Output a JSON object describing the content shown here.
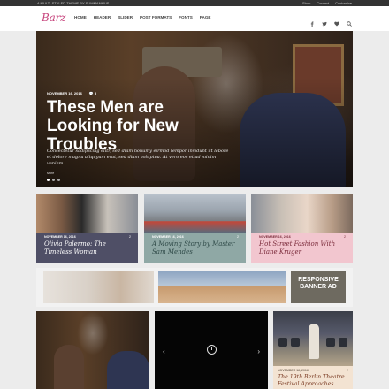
{
  "topbar": {
    "tagline": "A MULTI-STYLED THEME BY SUMMANMUS",
    "links": [
      "Shop",
      "Contact",
      "Customize"
    ]
  },
  "header": {
    "logo": "Barz",
    "nav": [
      "HOME",
      "HEADER",
      "SLIDER",
      "POST FORMATS",
      "FONTS",
      "PAGE"
    ],
    "social_icons": [
      "facebook-icon",
      "twitter-icon",
      "heart-icon",
      "search-icon"
    ]
  },
  "hero": {
    "date": "NOVEMBER 16, 2016",
    "comments": "3",
    "title": "These Men are Looking for New Troubles",
    "excerpt": "Consectetur sadipscing elitr, sed diam nonumy eirmod tempor invidunt ut labore et dolore magna aliquyam erat, sed diam voluptua. At vero eos et ad minim veniam.",
    "more": "More",
    "slides_shown": 3
  },
  "cards": [
    {
      "date": "NOVEMBER 16, 2016",
      "comments": "2",
      "title": "Olivia Palermo: The Timeless Woman",
      "bg": "#4f4f66",
      "text_color": "#ffffff"
    },
    {
      "date": "NOVEMBER 16, 2016",
      "comments": "2",
      "title": "A Moving Story by Master Sam Mendes",
      "bg": "#8fa8a5",
      "text_color": "#2f4a48"
    },
    {
      "date": "NOVEMBER 16, 2016",
      "comments": "2",
      "title": "Hot Street Fashion With Diane Kruger",
      "bg": "#f2c6cf",
      "text_color": "#7a2a3a"
    }
  ],
  "banner": {
    "label": "RESPONSIVE BANNER AD"
  },
  "bottom_right": {
    "date": "NOVEMBER 16, 2016",
    "comments": "2",
    "title": "The 19th Berlin Theatre Festival Approaches"
  },
  "colors": {
    "brand": "#c7457d",
    "topbar": "#333333"
  }
}
